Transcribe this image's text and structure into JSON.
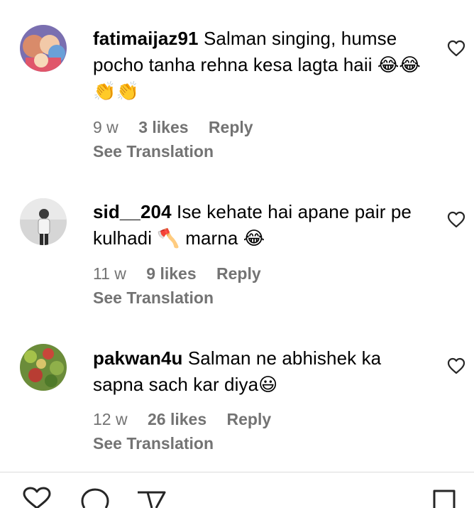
{
  "comments": [
    {
      "username": "fatimaijaz91",
      "text": "Salman singing, humse pocho tanha rehna kesa lagta haii 😂😂👏👏",
      "time": "9 w",
      "likes": "3 likes",
      "reply": "Reply",
      "translation": "See Translation"
    },
    {
      "username": "sid__204",
      "text": "Ise kehate hai apane pair pe kulhadi 🪓 marna 😂",
      "time": "11 w",
      "likes": "9 likes",
      "reply": "Reply",
      "translation": "See Translation"
    },
    {
      "username": "pakwan4u",
      "text": "Salman ne abhishek ka sapna sach kar diya😃",
      "time": "12 w",
      "likes": "26 likes",
      "reply": "Reply",
      "translation": "See Translation"
    }
  ],
  "icons": {
    "like": "heart-outline-icon",
    "bottom_bar": [
      "heart-icon",
      "comment-icon",
      "share-icon",
      "save-icon"
    ]
  },
  "colors": {
    "text": "#000000",
    "muted": "#737373",
    "divider": "#dbdbdb"
  }
}
